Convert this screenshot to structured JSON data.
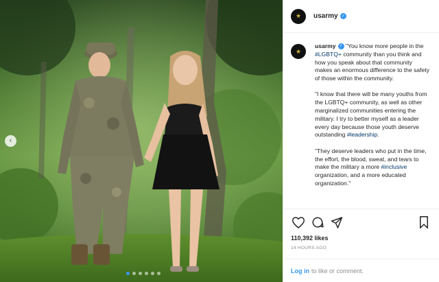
{
  "account": {
    "username": "usarmy",
    "verified_icon": "verified-badge-icon",
    "avatar_icon": "army-star-logo"
  },
  "caption": {
    "paragraphs": [
      [
        {
          "text": "\"You know more people in the ",
          "link": false
        },
        {
          "text": "#LGBTQ+",
          "link": true
        },
        {
          "text": " community than you think and how you speak about that community makes an enormous difference to the safety of those within the community.",
          "link": false
        }
      ],
      [
        {
          "text": "\"I know that there will be many youths from the LGBTQ+ community, as well as other marginalized communities entering the military. I try to better myself as a leader every day because those youth deserve outstanding ",
          "link": false
        },
        {
          "text": "#leadership",
          "link": true
        },
        {
          "text": ".",
          "link": false
        }
      ],
      [
        {
          "text": "\"They deserve leaders who put in the time, the effort, the blood, sweat, and tears to make the military a more ",
          "link": false
        },
        {
          "text": "#inclusive",
          "link": true
        },
        {
          "text": " organization, and a more educated organization.\"",
          "link": false
        }
      ]
    ]
  },
  "actions": {
    "icons": [
      "heart-icon",
      "comment-icon",
      "share-icon",
      "bookmark-icon"
    ]
  },
  "likes": "110,392 likes",
  "timestamp": "14 HOURS AGO",
  "login": {
    "link_text": "Log in",
    "rest_text": "to like or comment."
  },
  "carousel": {
    "total_slides": 6,
    "active_index": 0
  },
  "colors": {
    "link": "#003569",
    "accent": "#3897f0",
    "muted": "#8e8e8e"
  }
}
